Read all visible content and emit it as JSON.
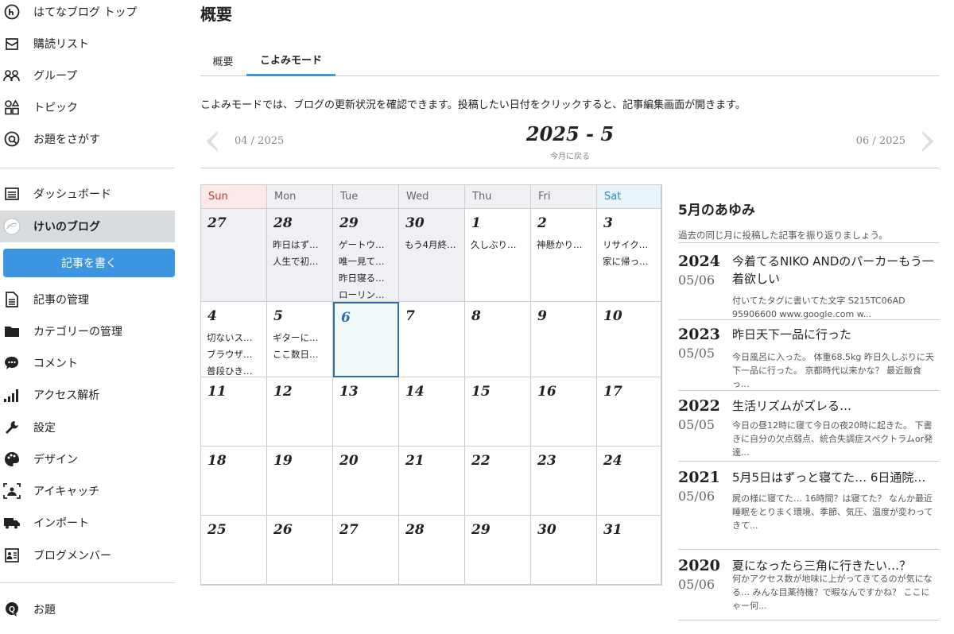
{
  "sidebar": {
    "top_items": [
      {
        "label": "はてなブログ トップ",
        "icon": "hatena-logo-icon"
      },
      {
        "label": "購読リスト",
        "icon": "subscription-icon"
      },
      {
        "label": "グループ",
        "icon": "group-icon"
      },
      {
        "label": "トピック",
        "icon": "topic-icon"
      },
      {
        "label": "お題をさがす",
        "icon": "theme-search-icon"
      }
    ],
    "dashboard_label": "ダッシュボード",
    "blog_name": "けいのブログ",
    "write_button": "記事を書く",
    "manage_items": [
      {
        "label": "記事の管理",
        "icon": "document-icon"
      },
      {
        "label": "カテゴリーの管理",
        "icon": "folder-icon"
      },
      {
        "label": "コメント",
        "icon": "comment-icon"
      },
      {
        "label": "アクセス解析",
        "icon": "bar-chart-icon"
      },
      {
        "label": "設定",
        "icon": "wrench-icon"
      },
      {
        "label": "デザイン",
        "icon": "palette-icon"
      },
      {
        "label": "アイキャッチ",
        "icon": "image-frame-icon"
      },
      {
        "label": "インポート",
        "icon": "truck-icon"
      },
      {
        "label": "ブログメンバー",
        "icon": "member-icon"
      }
    ],
    "odai_label": "お題"
  },
  "main": {
    "title": "概要",
    "tabs": [
      "概要",
      "こよみモード"
    ],
    "active_tab": "こよみモード",
    "description": "こよみモードでは、ブログの更新状況を確認できます。投稿したい日付をクリックすると、記事編集画面が開きます。"
  },
  "month_nav": {
    "prev": "04 / 2025",
    "current": "2025 - 5",
    "back_label": "今月に戻る",
    "next": "06 / 2025"
  },
  "calendar": {
    "weekdays": [
      "Sun",
      "Mon",
      "Tue",
      "Wed",
      "Thu",
      "Fri",
      "Sat"
    ],
    "weeks": [
      [
        {
          "day": "27",
          "other": true,
          "posts": []
        },
        {
          "day": "28",
          "other": true,
          "posts": [
            "昨日はず…",
            "人生で初…"
          ]
        },
        {
          "day": "29",
          "other": true,
          "posts": [
            "ゲートウ…",
            "唯一見て…",
            "昨日寝る…",
            "ローリン…"
          ]
        },
        {
          "day": "30",
          "other": true,
          "posts": [
            "もう4月終…"
          ]
        },
        {
          "day": "1",
          "posts": [
            "久しぶり…"
          ]
        },
        {
          "day": "2",
          "posts": [
            "神懸かり…"
          ]
        },
        {
          "day": "3",
          "posts": [
            "リサイク…",
            "家に帰っ…"
          ]
        }
      ],
      [
        {
          "day": "4",
          "posts": [
            "切ないス…",
            "ブラウザ…",
            "普段ひき…"
          ]
        },
        {
          "day": "5",
          "posts": [
            "ギターに…",
            "ここ数日…"
          ]
        },
        {
          "day": "6",
          "today": true,
          "posts": []
        },
        {
          "day": "7",
          "posts": []
        },
        {
          "day": "8",
          "posts": []
        },
        {
          "day": "9",
          "posts": []
        },
        {
          "day": "10",
          "posts": []
        }
      ],
      [
        {
          "day": "11",
          "posts": []
        },
        {
          "day": "12",
          "posts": []
        },
        {
          "day": "13",
          "posts": []
        },
        {
          "day": "14",
          "posts": []
        },
        {
          "day": "15",
          "posts": []
        },
        {
          "day": "16",
          "posts": []
        },
        {
          "day": "17",
          "posts": []
        }
      ],
      [
        {
          "day": "18",
          "posts": []
        },
        {
          "day": "19",
          "posts": []
        },
        {
          "day": "20",
          "posts": []
        },
        {
          "day": "21",
          "posts": []
        },
        {
          "day": "22",
          "posts": []
        },
        {
          "day": "23",
          "posts": []
        },
        {
          "day": "24",
          "posts": []
        }
      ],
      [
        {
          "day": "25",
          "posts": []
        },
        {
          "day": "26",
          "posts": []
        },
        {
          "day": "27",
          "posts": []
        },
        {
          "day": "28",
          "posts": []
        },
        {
          "day": "29",
          "posts": []
        },
        {
          "day": "30",
          "posts": []
        },
        {
          "day": "31",
          "posts": []
        }
      ]
    ]
  },
  "history": {
    "title": "5月のあゆみ",
    "subtitle": "過去の同じ月に投稿した記事を振り返りましょう。",
    "items": [
      {
        "year": "2024",
        "date": "05/06",
        "title": "今着てるNIKO ANDのパーカーもう一着欲しい",
        "body": "付いてたタグに書いてた文字 S215TC06AD 95906600 www.google.com w..."
      },
      {
        "year": "2023",
        "date": "05/05",
        "title": "昨日天下一品に行った",
        "body": "今日風呂に入った。 体重68.5kg 昨日久しぶりに天下一品に行った。 京都時代以来かな？ 最近飯食っ..."
      },
      {
        "year": "2022",
        "date": "05/05",
        "title": "生活リズムがズレる…",
        "body": "今日の昼12時に寝て今日の夜20時に起きた。 下書きに自分の欠点弱点、統合失調症スペクトラムor発達..."
      },
      {
        "year": "2021",
        "date": "05/06",
        "title": "5月5日はずっと寝てた… 6日通院…",
        "body": "屍の様に寝てた… 16時間？は寝てた？ なんか最近睡眠をとりまく環境、季節、気圧、温度が変わってきて..."
      },
      {
        "year": "2020",
        "date": "05/06",
        "title": "夏になったら三角に行きたい…？",
        "body": "何かアクセス数が地味に上がってきてるのが気になる… みんな目薬待機？で暇なんですかね？ ここにゃー何..."
      }
    ]
  }
}
